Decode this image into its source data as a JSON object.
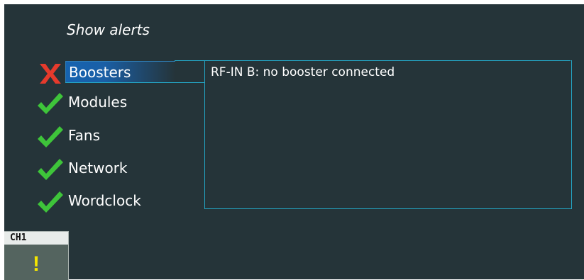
{
  "header": {
    "title": "Show alerts"
  },
  "alerts": {
    "items": [
      {
        "label": "Boosters",
        "status": "error",
        "icon": "cross-icon"
      },
      {
        "label": "Modules",
        "status": "ok",
        "icon": "check-icon"
      },
      {
        "label": "Fans",
        "status": "ok",
        "icon": "check-icon"
      },
      {
        "label": "Network",
        "status": "ok",
        "icon": "check-icon"
      },
      {
        "label": "Wordclock",
        "status": "ok",
        "icon": "check-icon"
      }
    ],
    "selected_index": 0
  },
  "detail": {
    "message": "RF-IN B: no booster connected"
  },
  "channel": {
    "label": "CH1",
    "indicator": "!",
    "indicator_icon": "warning-icon"
  },
  "colors": {
    "background": "#253439",
    "ok": "#3ec43a",
    "error": "#e53a2c",
    "selection": "#1663b0",
    "panel_border": "#24a5c4",
    "warning": "#f5e600"
  }
}
